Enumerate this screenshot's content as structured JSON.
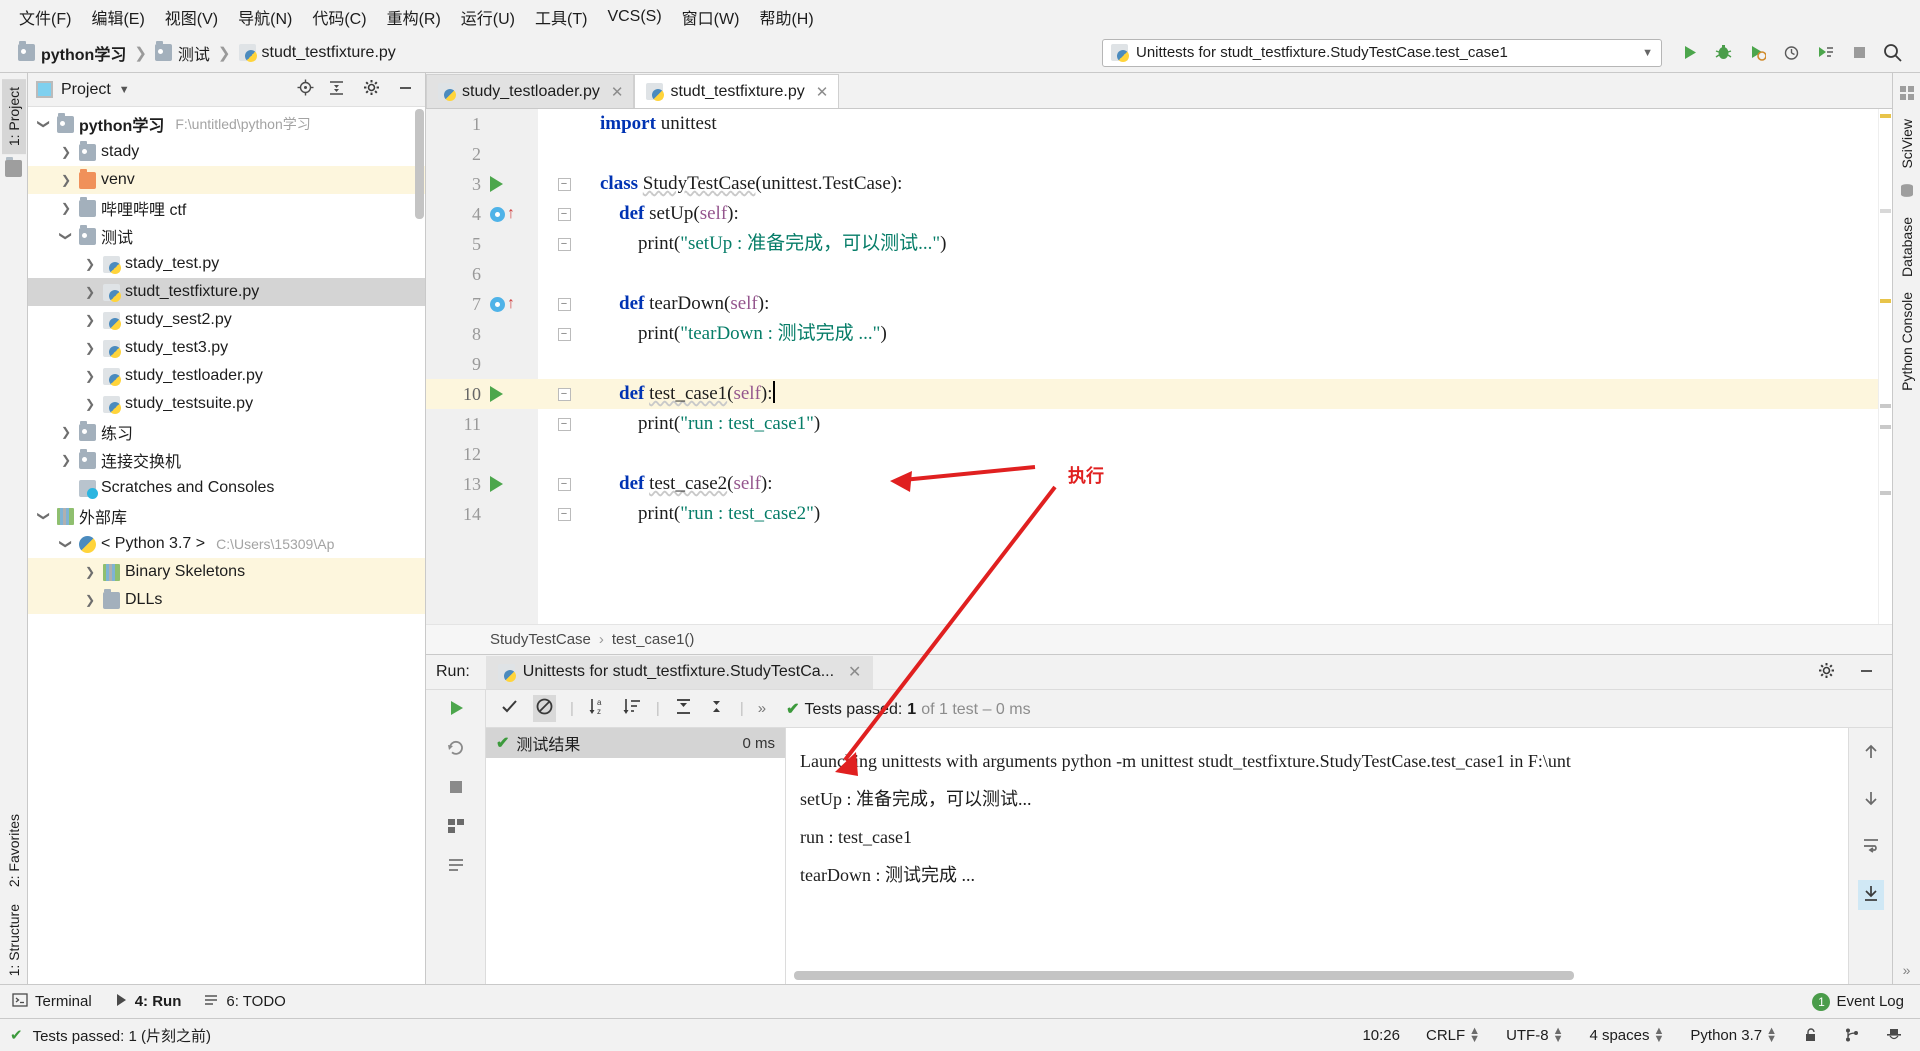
{
  "menubar": {
    "items": [
      {
        "label": "文件(F)",
        "mnemonic": "F"
      },
      {
        "label": "编辑(E)",
        "mnemonic": "E"
      },
      {
        "label": "视图(V)",
        "mnemonic": "V"
      },
      {
        "label": "导航(N)",
        "mnemonic": "N"
      },
      {
        "label": "代码(C)",
        "mnemonic": "C"
      },
      {
        "label": "重构(R)",
        "mnemonic": "R"
      },
      {
        "label": "运行(U)",
        "mnemonic": "U"
      },
      {
        "label": "工具(T)",
        "mnemonic": "T"
      },
      {
        "label": "VCS(S)",
        "mnemonic": "S"
      },
      {
        "label": "窗口(W)",
        "mnemonic": "W"
      },
      {
        "label": "帮助(H)",
        "mnemonic": "H"
      }
    ]
  },
  "navbar": {
    "breadcrumbs": [
      "python学习",
      "测试",
      "studt_testfixture.py"
    ],
    "run_configuration": "Unittests for studt_testfixture.StudyTestCase.test_case1",
    "buttons": [
      "run-button",
      "debug-button",
      "run-coverage-button",
      "profile-button",
      "run-with-console-button",
      "stop-button",
      "search-button"
    ]
  },
  "left_strip": {
    "tabs": [
      "1: Project"
    ],
    "bottom_tabs": [
      "2: Favorites",
      "1: Structure"
    ]
  },
  "right_strip": {
    "tabs": [
      "SciView",
      "Database",
      "Python Console"
    ]
  },
  "project_panel": {
    "title": "Project",
    "toolbar_icons": [
      "locate-icon",
      "collapse-all-icon",
      "gear-icon",
      "minimize-icon"
    ],
    "tree": [
      {
        "indent": 0,
        "arrow": "down",
        "icon": "folder",
        "label": "python学习",
        "bold": true,
        "path": "F:\\untitled\\python学习",
        "state": "normal"
      },
      {
        "indent": 1,
        "arrow": "right",
        "icon": "folder",
        "label": "stady",
        "state": "normal"
      },
      {
        "indent": 1,
        "arrow": "right",
        "icon": "folder-orange",
        "label": "venv",
        "state": "highlight"
      },
      {
        "indent": 1,
        "arrow": "right",
        "icon": "folder-plain",
        "label": "哔哩哔哩 ctf",
        "state": "normal"
      },
      {
        "indent": 1,
        "arrow": "down",
        "icon": "folder",
        "label": "测试",
        "state": "normal"
      },
      {
        "indent": 2,
        "arrow": "right",
        "icon": "python-file",
        "label": "stady_test.py",
        "state": "normal"
      },
      {
        "indent": 2,
        "arrow": "right",
        "icon": "python-file",
        "label": "studt_testfixture.py",
        "state": "selected"
      },
      {
        "indent": 2,
        "arrow": "right",
        "icon": "python-file",
        "label": "study_sest2.py",
        "state": "normal"
      },
      {
        "indent": 2,
        "arrow": "right",
        "icon": "python-file",
        "label": "study_test3.py",
        "state": "normal"
      },
      {
        "indent": 2,
        "arrow": "right",
        "icon": "python-file",
        "label": "study_testloader.py",
        "state": "normal"
      },
      {
        "indent": 2,
        "arrow": "right",
        "icon": "python-file",
        "label": "study_testsuite.py",
        "state": "normal"
      },
      {
        "indent": 1,
        "arrow": "right",
        "icon": "folder",
        "label": "练习",
        "state": "normal"
      },
      {
        "indent": 1,
        "arrow": "right",
        "icon": "folder",
        "label": "连接交换机",
        "state": "normal"
      },
      {
        "indent": 1,
        "arrow": "none",
        "icon": "scratch",
        "label": "Scratches and Consoles",
        "state": "normal"
      },
      {
        "indent": 0,
        "arrow": "down",
        "icon": "library",
        "label": "外部库",
        "state": "normal"
      },
      {
        "indent": 1,
        "arrow": "down",
        "icon": "python-round",
        "label": "< Python 3.7 >",
        "path": "C:\\Users\\15309\\Ap",
        "state": "normal"
      },
      {
        "indent": 2,
        "arrow": "right",
        "icon": "library",
        "label": "Binary Skeletons",
        "state": "highlight"
      },
      {
        "indent": 2,
        "arrow": "right",
        "icon": "folder-plain",
        "label": "DLLs",
        "state": "highlight"
      }
    ]
  },
  "editor": {
    "tabs": [
      {
        "label": "study_testloader.py",
        "active": false
      },
      {
        "label": "studt_testfixture.py",
        "active": true
      }
    ],
    "lines": [
      {
        "num": "1",
        "marker": "none",
        "fold": "none",
        "highlight": false,
        "tokens": [
          {
            "t": "kw",
            "v": "import "
          },
          {
            "t": "plain",
            "v": "unittest"
          }
        ]
      },
      {
        "num": "2",
        "marker": "none",
        "fold": "none",
        "highlight": false,
        "tokens": []
      },
      {
        "num": "3",
        "marker": "run",
        "fold": "open",
        "highlight": false,
        "tokens": [
          {
            "t": "kw",
            "v": "class "
          },
          {
            "t": "squig",
            "v": "StudyTestCase"
          },
          {
            "t": "plain",
            "v": "(unittest.TestCase):"
          }
        ]
      },
      {
        "num": "4",
        "marker": "override",
        "fold": "open",
        "highlight": false,
        "tokens": [
          {
            "t": "plain",
            "v": "    "
          },
          {
            "t": "kw",
            "v": "def "
          },
          {
            "t": "fn",
            "v": "setUp"
          },
          {
            "t": "plain",
            "v": "("
          },
          {
            "t": "slf",
            "v": "self"
          },
          {
            "t": "plain",
            "v": "):"
          }
        ]
      },
      {
        "num": "5",
        "marker": "none",
        "fold": "close",
        "highlight": false,
        "tokens": [
          {
            "t": "plain",
            "v": "        print("
          },
          {
            "t": "str",
            "v": "\"setUp : 准备完成，可以测试...\""
          },
          {
            "t": "plain",
            "v": ")"
          }
        ]
      },
      {
        "num": "6",
        "marker": "none",
        "fold": "none",
        "highlight": false,
        "tokens": []
      },
      {
        "num": "7",
        "marker": "override",
        "fold": "open",
        "highlight": false,
        "tokens": [
          {
            "t": "plain",
            "v": "    "
          },
          {
            "t": "kw",
            "v": "def "
          },
          {
            "t": "fn",
            "v": "tearDown"
          },
          {
            "t": "plain",
            "v": "("
          },
          {
            "t": "slf",
            "v": "self"
          },
          {
            "t": "plain",
            "v": "):"
          }
        ]
      },
      {
        "num": "8",
        "marker": "none",
        "fold": "close",
        "highlight": false,
        "tokens": [
          {
            "t": "plain",
            "v": "        print("
          },
          {
            "t": "str",
            "v": "\"tearDown : 测试完成 ...\""
          },
          {
            "t": "plain",
            "v": ")"
          }
        ]
      },
      {
        "num": "9",
        "marker": "none",
        "fold": "none",
        "highlight": false,
        "tokens": []
      },
      {
        "num": "10",
        "marker": "run",
        "fold": "open",
        "highlight": true,
        "tokens": [
          {
            "t": "plain",
            "v": "    "
          },
          {
            "t": "kw",
            "v": "def "
          },
          {
            "t": "squig",
            "v": "test_case1"
          },
          {
            "t": "plain",
            "v": "("
          },
          {
            "t": "slf",
            "v": "self"
          },
          {
            "t": "plain",
            "v": "):"
          },
          {
            "t": "caret",
            "v": ""
          }
        ]
      },
      {
        "num": "11",
        "marker": "none",
        "fold": "close",
        "highlight": false,
        "tokens": [
          {
            "t": "plain",
            "v": "        print("
          },
          {
            "t": "str",
            "v": "\"run : test_case1\""
          },
          {
            "t": "plain",
            "v": ")"
          }
        ]
      },
      {
        "num": "12",
        "marker": "none",
        "fold": "none",
        "highlight": false,
        "tokens": []
      },
      {
        "num": "13",
        "marker": "run",
        "fold": "open",
        "highlight": false,
        "tokens": [
          {
            "t": "plain",
            "v": "    "
          },
          {
            "t": "kw",
            "v": "def "
          },
          {
            "t": "squig",
            "v": "test_case2"
          },
          {
            "t": "plain",
            "v": "("
          },
          {
            "t": "slf",
            "v": "self"
          },
          {
            "t": "plain",
            "v": "):"
          }
        ]
      },
      {
        "num": "14",
        "marker": "none",
        "fold": "close",
        "highlight": false,
        "tokens": [
          {
            "t": "plain",
            "v": "        print("
          },
          {
            "t": "str",
            "v": "\"run : test_case2\""
          },
          {
            "t": "plain",
            "v": ")"
          }
        ]
      }
    ],
    "breadcrumb": [
      "StudyTestCase",
      "test_case1()"
    ]
  },
  "annotation": {
    "label": "执行",
    "color": "#e02020"
  },
  "run_panel": {
    "label": "Run:",
    "tab_title": "Unittests for studt_testfixture.StudyTestCa...",
    "toolbar_icons": [
      "rerun-icon",
      "rerun-failed-icon",
      "stop-icon",
      "dump-threads-icon",
      "pin-icon"
    ],
    "test_toolbar_icons": [
      "show-passed-icon",
      "hide-ignored-icon",
      "sort-alphabetically-icon",
      "sort-by-duration-icon",
      "expand-all-icon",
      "collapse-all-icon",
      "more-icon"
    ],
    "status": {
      "text": "Tests passed: ",
      "count": "1",
      "suffix": " of 1 test – 0 ms"
    },
    "test_rows": [
      {
        "label": "测试结果",
        "duration": "0 ms",
        "state": "passed"
      }
    ],
    "console_lines": [
      "Launching unittests with arguments python -m unittest studt_testfixture.StudyTestCase.test_case1 in F:\\unt",
      "setUp : 准备完成，可以测试...",
      "run : test_case1",
      "tearDown : 测试完成 ..."
    ],
    "console_side_icons": [
      "scroll-up-icon",
      "scroll-down-icon",
      "soft-wrap-icon",
      "scroll-to-end-icon"
    ]
  },
  "toolwindow_bar": {
    "items": [
      {
        "label": "Terminal",
        "icon": "terminal-icon",
        "selected": false
      },
      {
        "label": "4: Run",
        "icon": "run-icon",
        "selected": true
      },
      {
        "label": "6: TODO",
        "icon": "todo-icon",
        "selected": false
      }
    ],
    "event_log": {
      "label": "Event Log",
      "count": "1"
    }
  },
  "statusbar": {
    "message": "Tests passed: 1 (片刻之前)",
    "time": "10:26",
    "line_separator": "CRLF",
    "encoding": "UTF-8",
    "indent": "4 spaces",
    "interpreter": "Python 3.7",
    "icons": [
      "lock-icon",
      "git-branch-icon",
      "hector-icon"
    ]
  }
}
